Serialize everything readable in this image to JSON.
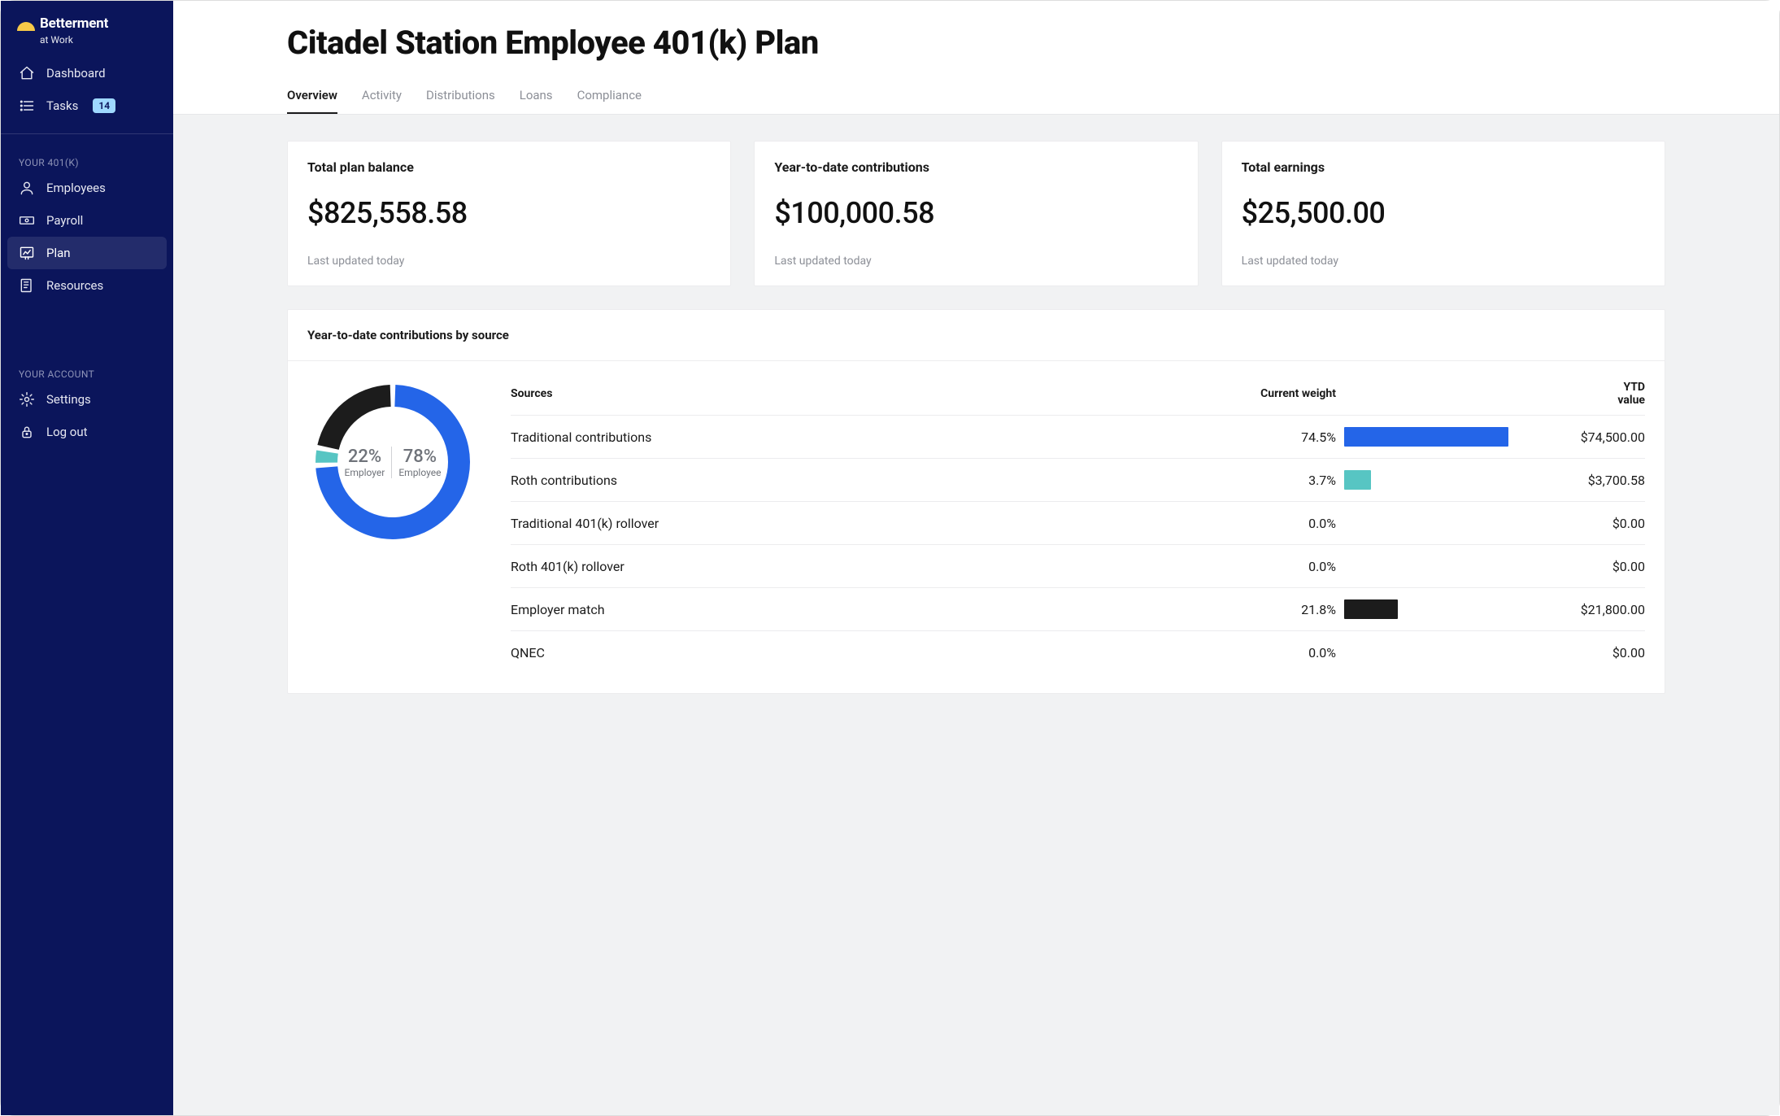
{
  "brand": {
    "name": "Betterment",
    "tagline": "at Work"
  },
  "sidebar": {
    "top": [
      {
        "icon": "home",
        "label": "Dashboard"
      },
      {
        "icon": "list",
        "label": "Tasks",
        "badge": "14"
      }
    ],
    "sections": [
      {
        "heading": "YOUR 401(K)",
        "items": [
          {
            "icon": "user",
            "label": "Employees"
          },
          {
            "icon": "money",
            "label": "Payroll"
          },
          {
            "icon": "chart",
            "label": "Plan",
            "active": true
          },
          {
            "icon": "book",
            "label": "Resources"
          }
        ]
      },
      {
        "heading": "YOUR ACCOUNT",
        "items": [
          {
            "icon": "gear",
            "label": "Settings"
          },
          {
            "icon": "lock",
            "label": "Log out"
          }
        ]
      }
    ]
  },
  "page": {
    "title": "Citadel Station Employee 401(k) Plan",
    "tabs": [
      "Overview",
      "Activity",
      "Distributions",
      "Loans",
      "Compliance"
    ],
    "activeTab": 0
  },
  "cards": [
    {
      "title": "Total plan balance",
      "value": "$825,558.58",
      "meta": "Last updated today"
    },
    {
      "title": "Year-to-date contributions",
      "value": "$100,000.58",
      "meta": "Last updated today"
    },
    {
      "title": "Total earnings",
      "value": "$25,500.00",
      "meta": "Last updated today"
    }
  ],
  "contrib": {
    "title": "Year-to-date contributions by source",
    "colors": {
      "employee_traditional": "#2465e8",
      "employee_roth": "#57c5c3",
      "employer": "#1c1c1c",
      "bar_employee": "#2465e8",
      "bar_roth": "#57c5c3",
      "bar_employer": "#1c1c1c"
    },
    "donut": {
      "employer_pct": "22%",
      "employee_pct": "78%",
      "employer_label": "Employer",
      "employee_label": "Employee"
    },
    "headers": {
      "source": "Sources",
      "weight": "Current weight",
      "ytd_line1": "YTD",
      "ytd_line2": "value"
    },
    "rows": [
      {
        "source": "Traditional contributions",
        "weight": "74.5%",
        "bar_pct": 92,
        "bar_color": "#2465e8",
        "ytd": "$74,500.00"
      },
      {
        "source": "Roth contributions",
        "weight": "3.7%",
        "bar_pct": 15,
        "bar_color": "#57c5c3",
        "ytd": "$3,700.58"
      },
      {
        "source": "Traditional 401(k) rollover",
        "weight": "0.0%",
        "bar_pct": 0,
        "bar_color": "#2465e8",
        "ytd": "$0.00"
      },
      {
        "source": "Roth 401(k) rollover",
        "weight": "0.0%",
        "bar_pct": 0,
        "bar_color": "#2465e8",
        "ytd": "$0.00"
      },
      {
        "source": "Employer match",
        "weight": "21.8%",
        "bar_pct": 30,
        "bar_color": "#1c1c1c",
        "ytd": "$21,800.00"
      },
      {
        "source": "QNEC",
        "weight": "0.0%",
        "bar_pct": 0,
        "bar_color": "#2465e8",
        "ytd": "$0.00"
      }
    ]
  },
  "chart_data": {
    "type": "pie",
    "title": "Year-to-date contributions by source",
    "categories": [
      "Employer",
      "Employee – Traditional",
      "Employee – Roth"
    ],
    "values": [
      22,
      74.3,
      3.7
    ],
    "colors": [
      "#1c1c1c",
      "#2465e8",
      "#57c5c3"
    ],
    "center_labels": [
      {
        "pct": 22,
        "label": "Employer"
      },
      {
        "pct": 78,
        "label": "Employee"
      }
    ],
    "table": [
      {
        "source": "Traditional contributions",
        "weight_pct": 74.5,
        "ytd_value": 74500.0
      },
      {
        "source": "Roth contributions",
        "weight_pct": 3.7,
        "ytd_value": 3700.58
      },
      {
        "source": "Traditional 401(k) rollover",
        "weight_pct": 0.0,
        "ytd_value": 0.0
      },
      {
        "source": "Roth 401(k) rollover",
        "weight_pct": 0.0,
        "ytd_value": 0.0
      },
      {
        "source": "Employer match",
        "weight_pct": 21.8,
        "ytd_value": 21800.0
      },
      {
        "source": "QNEC",
        "weight_pct": 0.0,
        "ytd_value": 0.0
      }
    ]
  }
}
